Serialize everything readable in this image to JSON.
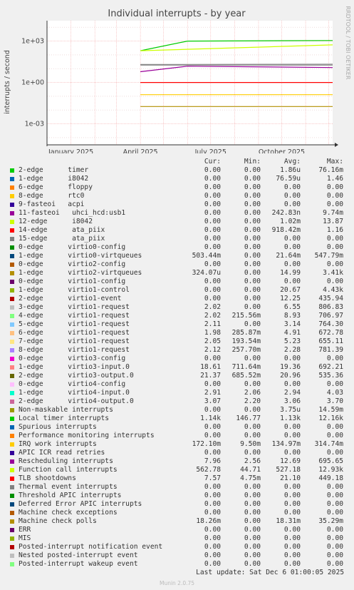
{
  "chart_data": {
    "type": "line",
    "title": "Individual interrupts - by year",
    "ylabel": "interrupts / second",
    "yscale": "log",
    "ylim": [
      3e-05,
      30000
    ],
    "ytick_labels": [
      "1e+03",
      "1e+00",
      "1e-03"
    ],
    "ytick_values": [
      1000,
      1,
      0.001
    ],
    "xlim": [
      "2024-12-01",
      "2025-12-06"
    ],
    "xtick_labels": [
      "January 2025",
      "April 2025",
      "July 2025",
      "October 2025"
    ],
    "xtick_values": [
      "2025-01-01",
      "2025-04-01",
      "2025-07-01",
      "2025-10-01"
    ],
    "grid": true,
    "series_approx": [
      {
        "name": "Local timer interrupts",
        "start": "2025-04-01",
        "segments": [
          [
            "2025-04-01",
            200
          ],
          [
            "2025-06-01",
            1000
          ],
          [
            "2025-12-06",
            1100
          ]
        ]
      },
      {
        "name": "Rescheduling interrupts",
        "start": "2025-04-01",
        "segments": [
          [
            "2025-04-01",
            6
          ],
          [
            "2025-06-01",
            15
          ],
          [
            "2025-12-06",
            12
          ]
        ]
      },
      {
        "name": "Function call interrupts",
        "start": "2025-04-01",
        "segments": [
          [
            "2025-04-01",
            200
          ],
          [
            "2025-12-06",
            530
          ]
        ]
      },
      {
        "name": "IRQ work interrupts",
        "start": "2025-04-01",
        "segments": [
          [
            "2025-04-01",
            0.13
          ],
          [
            "2025-12-06",
            0.13
          ]
        ]
      },
      {
        "name": "virtio3-output.0",
        "start": "2025-04-01",
        "segments": [
          [
            "2025-04-01",
            20
          ],
          [
            "2025-12-06",
            21
          ]
        ]
      },
      {
        "name": "virtio3-input.0",
        "start": "2025-04-01",
        "segments": [
          [
            "2025-04-01",
            18
          ],
          [
            "2025-12-06",
            18
          ]
        ]
      },
      {
        "name": "Machine check polls",
        "start": "2025-04-01",
        "segments": [
          [
            "2025-04-01",
            0.018
          ],
          [
            "2025-12-06",
            0.018
          ]
        ]
      },
      {
        "name": "TLB shootdowns",
        "start": "2025-04-01",
        "segments": [
          [
            "2025-04-01",
            1
          ],
          [
            "2025-12-06",
            1
          ]
        ]
      }
    ],
    "columns": [
      "Cur:",
      "Min:",
      "Avg:",
      "Max:"
    ],
    "rows": [
      {
        "label": "2-edge      timer",
        "color": "#00cc00",
        "cur": "0.00",
        "min": "0.00",
        "avg": "1.86u",
        "max": "76.16m"
      },
      {
        "label": "1-edge      i8042",
        "color": "#0066b3",
        "cur": "0.00",
        "min": "0.00",
        "avg": "76.59u",
        "max": "1.46"
      },
      {
        "label": "6-edge      floppy",
        "color": "#ff8000",
        "cur": "0.00",
        "min": "0.00",
        "avg": "0.00",
        "max": "0.00"
      },
      {
        "label": "8-edge      rtc0",
        "color": "#ffcc00",
        "cur": "0.00",
        "min": "0.00",
        "avg": "0.00",
        "max": "0.00"
      },
      {
        "label": "9-fasteoi   acpi",
        "color": "#330099",
        "cur": "0.00",
        "min": "0.00",
        "avg": "0.00",
        "max": "0.00"
      },
      {
        "label": "11-fasteoi   uhci_hcd:usb1",
        "color": "#990099",
        "cur": "0.00",
        "min": "0.00",
        "avg": "242.83n",
        "max": "9.74m"
      },
      {
        "label": "12-edge      i8042",
        "color": "#ccff00",
        "cur": "0.00",
        "min": "0.00",
        "avg": "1.02m",
        "max": "13.87"
      },
      {
        "label": "14-edge      ata_piix",
        "color": "#ff0000",
        "cur": "0.00",
        "min": "0.00",
        "avg": "918.42m",
        "max": "1.16"
      },
      {
        "label": "15-edge      ata_piix",
        "color": "#808080",
        "cur": "0.00",
        "min": "0.00",
        "avg": "0.00",
        "max": "0.00"
      },
      {
        "label": "0-edge      virtio0-config",
        "color": "#008f00",
        "cur": "0.00",
        "min": "0.00",
        "avg": "0.00",
        "max": "0.00"
      },
      {
        "label": "1-edge      virtio0-virtqueues",
        "color": "#00487d",
        "cur": "503.44m",
        "min": "0.00",
        "avg": "21.64m",
        "max": "547.79m"
      },
      {
        "label": "0-edge      virtio2-config",
        "color": "#b35a00",
        "cur": "0.00",
        "min": "0.00",
        "avg": "0.00",
        "max": "0.00"
      },
      {
        "label": "1-edge      virtio2-virtqueues",
        "color": "#b38f00",
        "cur": "324.07u",
        "min": "0.00",
        "avg": "14.99",
        "max": "3.41k"
      },
      {
        "label": "0-edge      virtio1-config",
        "color": "#6b006b",
        "cur": "0.00",
        "min": "0.00",
        "avg": "0.00",
        "max": "0.00"
      },
      {
        "label": "1-edge      virtio1-control",
        "color": "#8fb300",
        "cur": "0.00",
        "min": "0.00",
        "avg": "20.67",
        "max": "4.43k"
      },
      {
        "label": "2-edge      virtio1-event",
        "color": "#b30000",
        "cur": "0.00",
        "min": "0.00",
        "avg": "12.25",
        "max": "435.94"
      },
      {
        "label": "3-edge      virtio1-request",
        "color": "#bebebe",
        "cur": "2.02",
        "min": "0.00",
        "avg": "6.55",
        "max": "806.83"
      },
      {
        "label": "4-edge      virtio1-request",
        "color": "#80ff80",
        "cur": "2.02",
        "min": "215.56m",
        "avg": "8.93",
        "max": "706.97"
      },
      {
        "label": "5-edge      virtio1-request",
        "color": "#80c9ff",
        "cur": "2.11",
        "min": "0.00",
        "avg": "3.14",
        "max": "764.30"
      },
      {
        "label": "6-edge      virtio1-request",
        "color": "#ffc080",
        "cur": "1.98",
        "min": "285.87m",
        "avg": "4.91",
        "max": "672.78"
      },
      {
        "label": "7-edge      virtio1-request",
        "color": "#ffe680",
        "cur": "2.05",
        "min": "193.54m",
        "avg": "5.23",
        "max": "655.11"
      },
      {
        "label": "8-edge      virtio1-request",
        "color": "#aa80ff",
        "cur": "2.12",
        "min": "257.70m",
        "avg": "2.28",
        "max": "781.39"
      },
      {
        "label": "0-edge      virtio3-config",
        "color": "#ee00cc",
        "cur": "0.00",
        "min": "0.00",
        "avg": "0.00",
        "max": "0.00"
      },
      {
        "label": "1-edge      virtio3-input.0",
        "color": "#ff8080",
        "cur": "18.61",
        "min": "711.64m",
        "avg": "19.36",
        "max": "692.21"
      },
      {
        "label": "2-edge      virtio3-output.0",
        "color": "#666600",
        "cur": "21.37",
        "min": "685.52m",
        "avg": "20.96",
        "max": "535.36"
      },
      {
        "label": "0-edge      virtio4-config",
        "color": "#ffbfff",
        "cur": "0.00",
        "min": "0.00",
        "avg": "0.00",
        "max": "0.00"
      },
      {
        "label": "1-edge      virtio4-input.0",
        "color": "#00ffcc",
        "cur": "2.91",
        "min": "2.06",
        "avg": "2.94",
        "max": "4.03"
      },
      {
        "label": "2-edge      virtio4-output.0",
        "color": "#cc6699",
        "cur": "3.07",
        "min": "2.20",
        "avg": "3.06",
        "max": "3.70"
      },
      {
        "label": "Non-maskable interrupts",
        "color": "#999900",
        "cur": "0.00",
        "min": "0.00",
        "avg": "3.75u",
        "max": "14.59m"
      },
      {
        "label": "Local timer interrupts",
        "color": "#00cc00",
        "cur": "1.14k",
        "min": "146.77",
        "avg": "1.13k",
        "max": "12.16k"
      },
      {
        "label": "Spurious interrupts",
        "color": "#0066b3",
        "cur": "0.00",
        "min": "0.00",
        "avg": "0.00",
        "max": "0.00"
      },
      {
        "label": "Performance monitoring interrupts",
        "color": "#ff8000",
        "cur": "0.00",
        "min": "0.00",
        "avg": "0.00",
        "max": "0.00"
      },
      {
        "label": "IRQ work interrupts",
        "color": "#ffcc00",
        "cur": "172.10m",
        "min": "9.50m",
        "avg": "134.97m",
        "max": "314.74m"
      },
      {
        "label": "APIC ICR read retries",
        "color": "#330099",
        "cur": "0.00",
        "min": "0.00",
        "avg": "0.00",
        "max": "0.00"
      },
      {
        "label": "Rescheduling interrupts",
        "color": "#990099",
        "cur": "7.96",
        "min": "2.56",
        "avg": "12.69",
        "max": "695.65"
      },
      {
        "label": "Function call interrupts",
        "color": "#ccff00",
        "cur": "562.78",
        "min": "44.71",
        "avg": "527.18",
        "max": "12.93k"
      },
      {
        "label": "TLB shootdowns",
        "color": "#ff0000",
        "cur": "7.57",
        "min": "4.75m",
        "avg": "21.10",
        "max": "449.18"
      },
      {
        "label": "Thermal event interrupts",
        "color": "#808080",
        "cur": "0.00",
        "min": "0.00",
        "avg": "0.00",
        "max": "0.00"
      },
      {
        "label": "Threshold APIC interrupts",
        "color": "#008f00",
        "cur": "0.00",
        "min": "0.00",
        "avg": "0.00",
        "max": "0.00"
      },
      {
        "label": "Deferred Error APIC interrupts",
        "color": "#00487d",
        "cur": "0.00",
        "min": "0.00",
        "avg": "0.00",
        "max": "0.00"
      },
      {
        "label": "Machine check exceptions",
        "color": "#b35a00",
        "cur": "0.00",
        "min": "0.00",
        "avg": "0.00",
        "max": "0.00"
      },
      {
        "label": "Machine check polls",
        "color": "#b38f00",
        "cur": "18.26m",
        "min": "0.00",
        "avg": "18.31m",
        "max": "35.29m"
      },
      {
        "label": "ERR",
        "color": "#6b006b",
        "cur": "0.00",
        "min": "0.00",
        "avg": "0.00",
        "max": "0.00"
      },
      {
        "label": "MIS",
        "color": "#8fb300",
        "cur": "0.00",
        "min": "0.00",
        "avg": "0.00",
        "max": "0.00"
      },
      {
        "label": "Posted-interrupt notification event",
        "color": "#b30000",
        "cur": "0.00",
        "min": "0.00",
        "avg": "0.00",
        "max": "0.00"
      },
      {
        "label": "Nested posted-interrupt event",
        "color": "#bebebe",
        "cur": "0.00",
        "min": "0.00",
        "avg": "0.00",
        "max": "0.00"
      },
      {
        "label": "Posted-interrupt wakeup event",
        "color": "#80ff80",
        "cur": "0.00",
        "min": "0.00",
        "avg": "0.00",
        "max": "0.00"
      }
    ]
  },
  "last_update": "Last update: Sat Dec  6 01:00:05 2025",
  "footer": "Munin 2.0.75",
  "side_label": "RRDTOOL / TOBI OETIKER"
}
